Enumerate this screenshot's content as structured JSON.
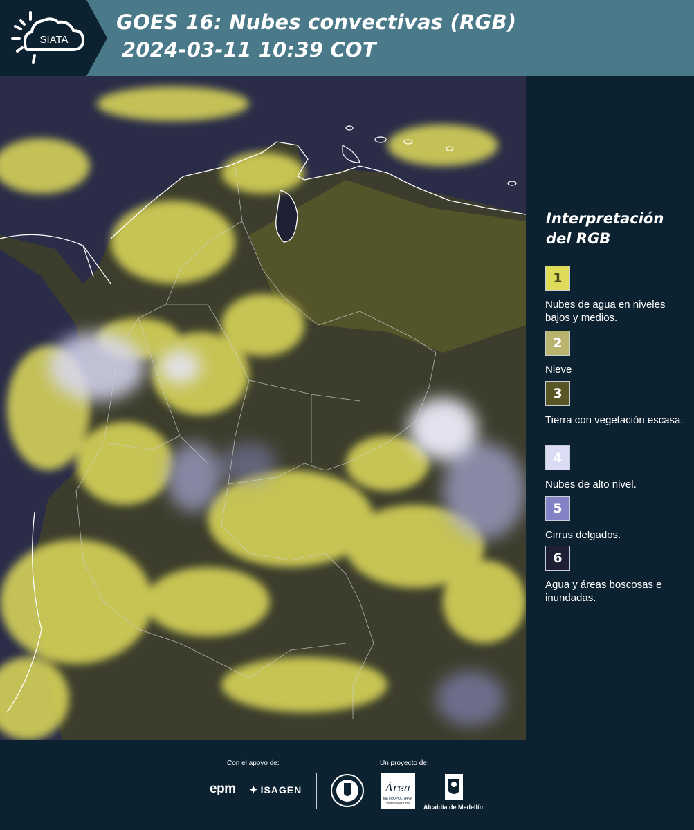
{
  "header": {
    "logo_text": "SIATA",
    "title_line1": "GOES 16: Nubes convectivas (RGB)",
    "title_line2": "2024-03-11 10:39 COT"
  },
  "map": {
    "icon": "satellite-rgb-map"
  },
  "legend": {
    "title": "Interpretación del RGB",
    "items": [
      {
        "number": "1",
        "label": "Nubes de agua en niveles bajos y medios.",
        "color": "#dfdc5a",
        "text_color": "#4a4a1f"
      },
      {
        "number": "2",
        "label": "Nieve",
        "color": "#b8b46e",
        "text_color": "#ffffff"
      },
      {
        "number": "3",
        "label": "Tierra con vegetación escasa.",
        "color": "#5a5524",
        "text_color": "#ffffff"
      },
      {
        "number": "4",
        "label": "Nubes de alto nivel.",
        "color": "#dcdcf4",
        "text_color": "#ffffff"
      },
      {
        "number": "5",
        "label": "Cirrus delgados.",
        "color": "#8282c4",
        "text_color": "#ffffff"
      },
      {
        "number": "6",
        "label": "Agua y áreas boscosas e inundadas.",
        "color": "#1e1f34",
        "text_color": "#ffffff"
      }
    ]
  },
  "footer": {
    "support_label": "Con el apoyo de:",
    "project_label": "Un proyecto de:",
    "epm_logo": "epm",
    "isagen_logo": "ISAGEN",
    "metro_logo_text": "Área",
    "metro_sub1": "METROPOLITANA",
    "metro_sub2": "Valle de Aburrá",
    "alcaldia_text": "Alcaldía de Medellín"
  },
  "colors": {
    "header_bg": "#4a7a8a",
    "page_bg": "#0d2230",
    "cloud_yellow": "#dfdc5a",
    "high_cloud": "#dcdcf4",
    "land": "#4a4a24",
    "water": "#2a2c48"
  }
}
